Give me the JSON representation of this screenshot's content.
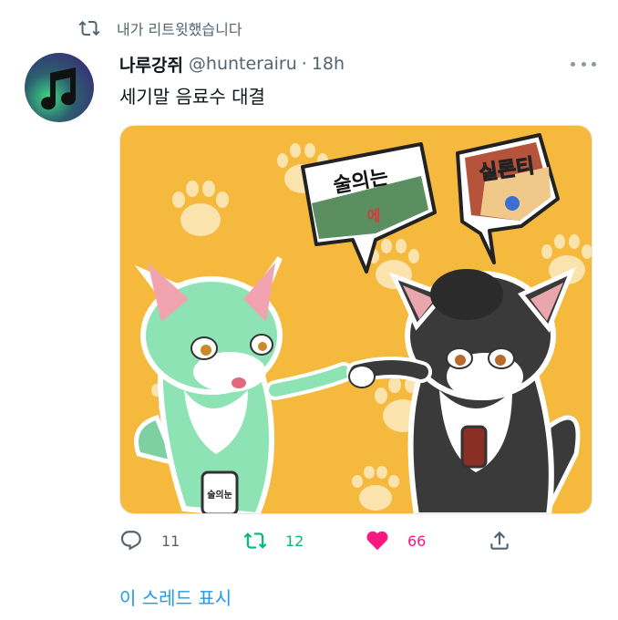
{
  "colors": {
    "accent": "#1d9bf0",
    "retweet_green": "#00ba7c",
    "like_pink": "#f91880",
    "muted": "#536471",
    "image_bg": "#f5b93e"
  },
  "retweet_context": {
    "icon": "retweet-icon",
    "text": "내가 리트윗했습니다"
  },
  "tweet": {
    "display_name": "나루강쥐",
    "handle": "@hunterairu",
    "separator": "·",
    "time": "18h",
    "text": "세기말 음료수 대결",
    "avatar_icon": "music-note-icon",
    "image": {
      "bubble_left": "술의는",
      "bubble_left_sub": "에",
      "bubble_right": "실론티",
      "can_label": "술의눈"
    }
  },
  "actions": {
    "reply": {
      "icon": "reply-icon",
      "count": "11"
    },
    "retweet": {
      "icon": "retweet-icon",
      "count": "12"
    },
    "like": {
      "icon": "heart-icon",
      "count": "66"
    },
    "share": {
      "icon": "share-icon"
    }
  },
  "thread_link": "이 스레드 표시"
}
